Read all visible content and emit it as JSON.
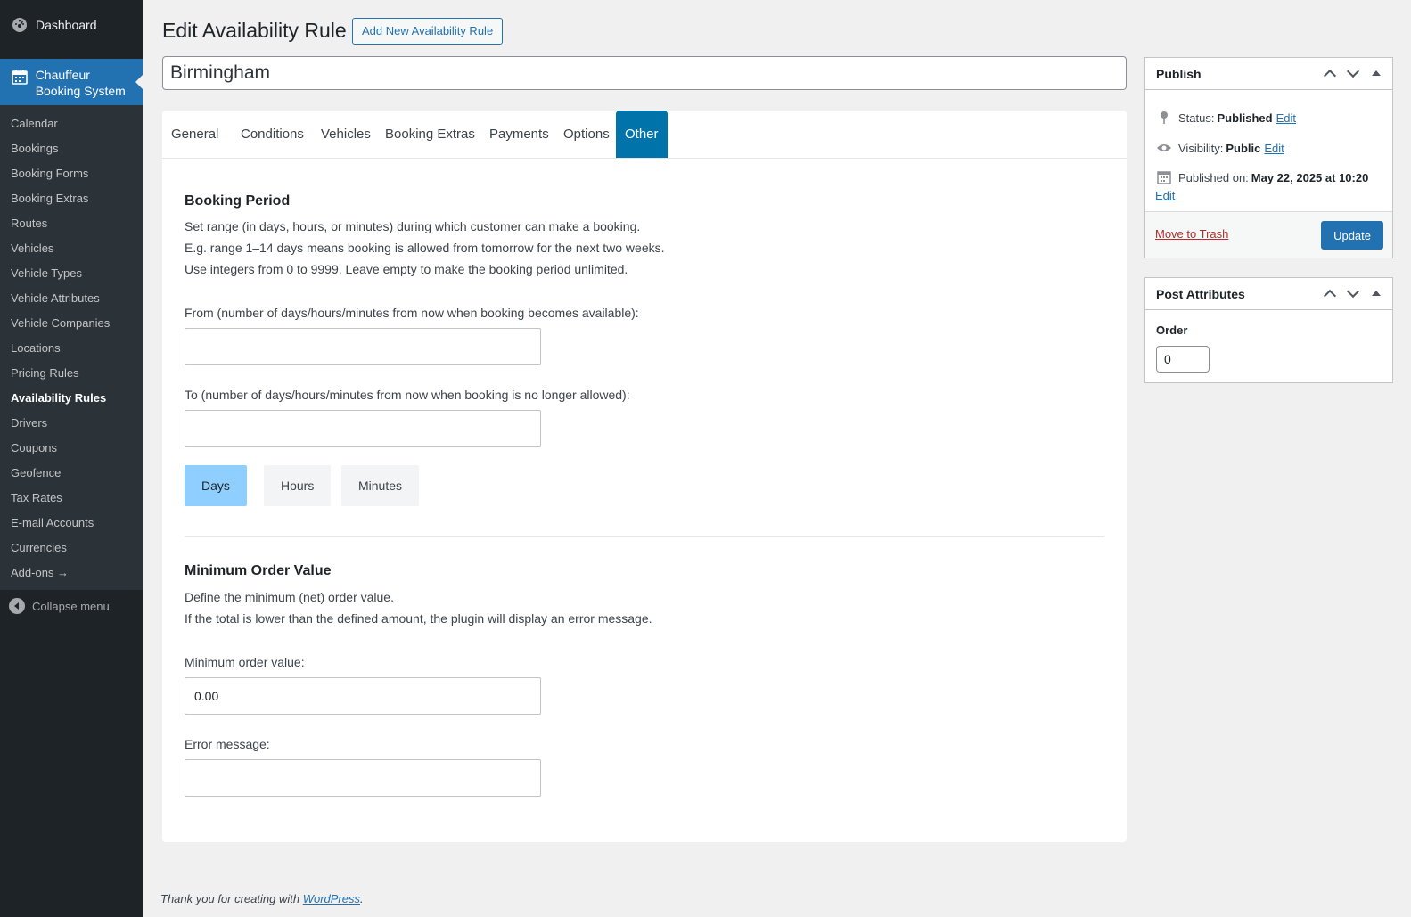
{
  "sidebar": {
    "dashboard_label": "Dashboard",
    "active_menu_label": "Chauffeur Booking System",
    "submenu": [
      {
        "label": "Calendar"
      },
      {
        "label": "Bookings"
      },
      {
        "label": "Booking Forms"
      },
      {
        "label": "Booking Extras"
      },
      {
        "label": "Routes"
      },
      {
        "label": "Vehicles"
      },
      {
        "label": "Vehicle Types"
      },
      {
        "label": "Vehicle Attributes"
      },
      {
        "label": "Vehicle Companies"
      },
      {
        "label": "Locations"
      },
      {
        "label": "Pricing Rules"
      },
      {
        "label": "Availability Rules"
      },
      {
        "label": "Drivers"
      },
      {
        "label": "Coupons"
      },
      {
        "label": "Geofence"
      },
      {
        "label": "Tax Rates"
      },
      {
        "label": "E-mail Accounts"
      },
      {
        "label": "Currencies"
      },
      {
        "label": "Add-ons →"
      }
    ],
    "current_item": "Availability Rules",
    "collapse_label": "Collapse menu"
  },
  "header": {
    "title": "Edit Availability Rule",
    "add_new_label": "Add New Availability Rule",
    "post_title_value": "Birmingham"
  },
  "tabs": [
    {
      "label": "General"
    },
    {
      "label": "Conditions"
    },
    {
      "label": "Vehicles"
    },
    {
      "label": "Booking Extras"
    },
    {
      "label": "Payments"
    },
    {
      "label": "Options"
    },
    {
      "label": "Other"
    }
  ],
  "active_tab": "Other",
  "booking_period": {
    "heading": "Booking Period",
    "desc1": "Set range (in days, hours, or minutes) during which customer can make a booking.",
    "desc2": "E.g. range 1–14 days means booking is allowed from tomorrow for the next two weeks.",
    "desc3": "Use integers from 0 to 9999. Leave empty to make the booking period unlimited.",
    "from_label": "From (number of days/hours/minutes from now when booking becomes available):",
    "from_value": "",
    "to_label": "To (number of days/hours/minutes from now when booking is no longer allowed):",
    "to_value": "",
    "units": [
      {
        "label": "Days",
        "active": true
      },
      {
        "label": "Hours",
        "active": false
      },
      {
        "label": "Minutes",
        "active": false
      }
    ]
  },
  "min_order": {
    "heading": "Minimum Order Value",
    "desc1": "Define the minimum (net) order value.",
    "desc2": "If the total is lower than the defined amount, the plugin will display an error message.",
    "value_label": "Minimum order value:",
    "value": "0.00",
    "error_label": "Error message:",
    "error_value": ""
  },
  "publish": {
    "title": "Publish",
    "status_label": "Status:",
    "status_value": "Published",
    "visibility_label": "Visibility:",
    "visibility_value": "Public",
    "published_label": "Published on:",
    "published_value": "May 22, 2025 at 10:20",
    "edit_label": "Edit",
    "trash_label": "Move to Trash",
    "update_label": "Update"
  },
  "post_attributes": {
    "title": "Post Attributes",
    "order_label": "Order",
    "order_value": "0"
  },
  "footer": {
    "text": "Thank you for creating with",
    "link": "WordPress",
    "period": "."
  },
  "colors": {
    "admin_bar": "#1d2327",
    "accent": "#2271b1",
    "active_tab": "#0073aa",
    "active_unit": "#8fcfff",
    "trash": "#b32d2e"
  }
}
